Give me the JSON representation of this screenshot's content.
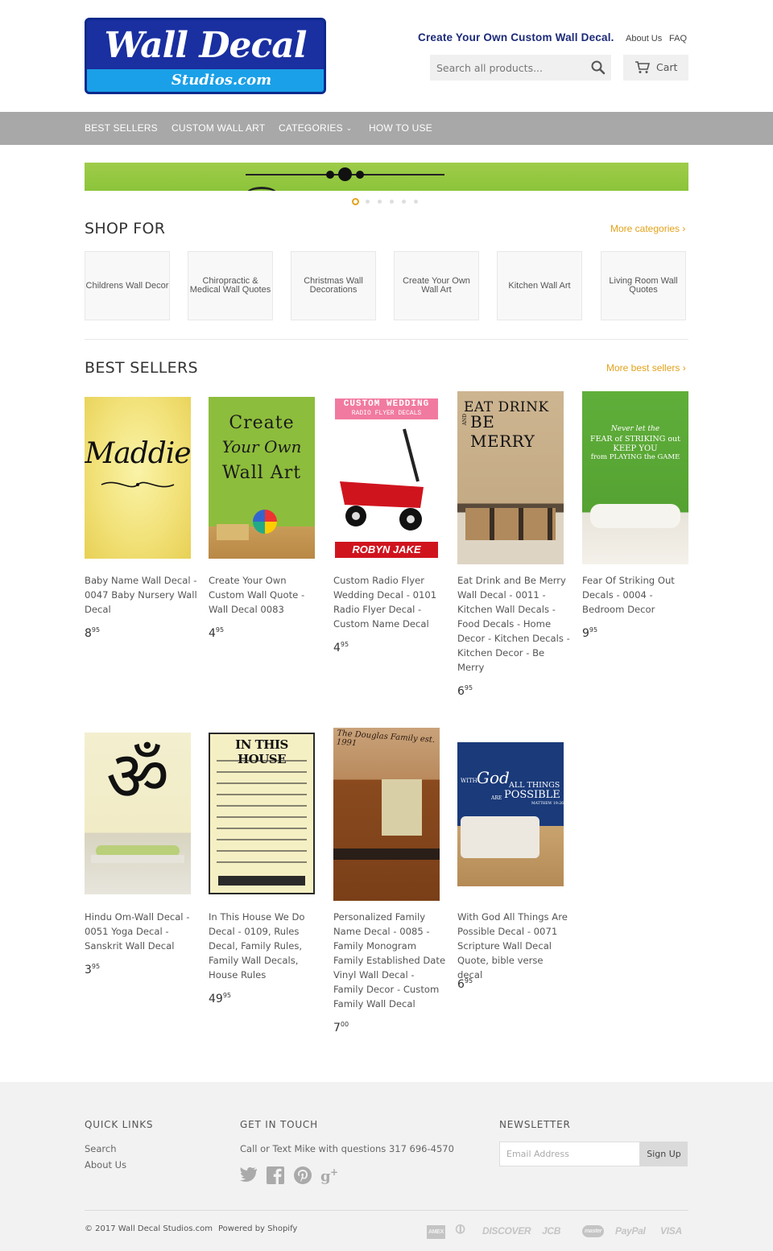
{
  "header": {
    "logo_main": "Wall Decal",
    "logo_sub": "Studios.com",
    "tagline": "Create Your Own Custom Wall Decal.",
    "links": [
      "About Us",
      "FAQ"
    ],
    "search_placeholder": "Search all products...",
    "cart_label": "Cart"
  },
  "nav": {
    "items": [
      "BEST SELLERS",
      "CUSTOM WALL ART",
      "CATEGORIES",
      "HOW TO USE"
    ]
  },
  "slideshow": {
    "slide_count": 6,
    "active_index": 0,
    "accent_color": "#e3a21a"
  },
  "shop_for": {
    "title": "SHOP FOR",
    "more_link": "More categories ›",
    "categories": [
      "Childrens Wall Decor",
      "Chiropractic & Medical Wall Quotes",
      "Christmas Wall Decorations",
      "Create Your Own Wall Art",
      "Kitchen Wall Art",
      "Living Room Wall Quotes"
    ]
  },
  "best_sellers": {
    "title": "BEST SELLERS",
    "more_link": "More best sellers ›",
    "products": [
      {
        "title": "Baby Name Wall Decal - 0047 Baby Nursery Wall Decal",
        "price_main": "8",
        "price_cents": "95",
        "image_text": "Maddie"
      },
      {
        "title": "Create Your Own Custom Wall Quote - Wall Decal 0083",
        "price_main": "4",
        "price_cents": "95",
        "image_text_1": "Create",
        "image_text_2": "Your Own",
        "image_text_3": "Wall Art"
      },
      {
        "title": "Custom Radio Flyer Wedding Decal - 0101 Radio Flyer Decal - Custom Name Decal",
        "price_main": "4",
        "price_cents": "95",
        "image_text_1": "CUSTOM WEDDING",
        "image_text_2": "RADIO FLYER DECALS",
        "image_text_3": "ROBYN JAKE"
      },
      {
        "title": "Eat Drink and Be Merry Wall Decal - 0011 - Kitchen Wall Decals - Food Decals - Home Decor - Kitchen Decals - Kitchen Decor - Be Merry",
        "price_main": "6",
        "price_cents": "95",
        "image_text_1": "EAT DRINK",
        "image_text_2": "BE MERRY",
        "image_text_3": "AND"
      },
      {
        "title": "Fear Of Striking Out Decals - 0004 - Bedroom Decor",
        "price_main": "9",
        "price_cents": "95",
        "image_text_1": "Never let the",
        "image_text_2": "FEAR of STRIKING out",
        "image_text_3": "KEEP YOU",
        "image_text_4": "from PLAYING the GAME"
      },
      {
        "title": "Hindu Om-Wall Decal - 0051 Yoga Decal - Sanskrit Wall Decal",
        "price_main": "3",
        "price_cents": "95",
        "image_text": "ॐ"
      },
      {
        "title": "In This House We Do Decal - 0109, Rules Decal, Family Rules, Family Wall Decals, House Rules",
        "price_main": "49",
        "price_cents": "95",
        "image_text": "IN THIS HOUSE"
      },
      {
        "title": "Personalized Family Name Decal - 0085 - Family Monogram Family Established Date Vinyl Wall Decal - Family Decor - Custom Family Wall Decal",
        "price_main": "7",
        "price_cents": "00",
        "image_text": "The Douglas Family est. 1991"
      },
      {
        "title": "With God All Things Are Possible Decal - 0071 Scripture Wall Decal Quote, bible verse decal",
        "price_main": "6",
        "price_cents": "95",
        "image_text_1": "WITH",
        "image_text_2": "God",
        "image_text_3": "ALL THINGS",
        "image_text_4": "ARE",
        "image_text_5": "POSSIBLE",
        "image_text_6": "MATTHEW 19:26"
      }
    ]
  },
  "footer": {
    "quick_links_title": "QUICK LINKS",
    "quick_links": [
      "Search",
      "About Us"
    ],
    "contact_title": "GET IN TOUCH",
    "contact_text": "Call or Text Mike with questions 317 696-4570",
    "social_icons": [
      "twitter-icon",
      "facebook-icon",
      "pinterest-icon",
      "google-plus-icon"
    ],
    "newsletter_title": "NEWSLETTER",
    "email_placeholder": "Email Address",
    "signup_label": "Sign Up",
    "copyright": "© 2017 Wall Decal Studios.com",
    "powered_by": "Powered by Shopify",
    "payments": [
      "AMEX",
      "⦶",
      "DISCOVER",
      "JCB",
      "master",
      "PayPal",
      "VISA"
    ]
  }
}
